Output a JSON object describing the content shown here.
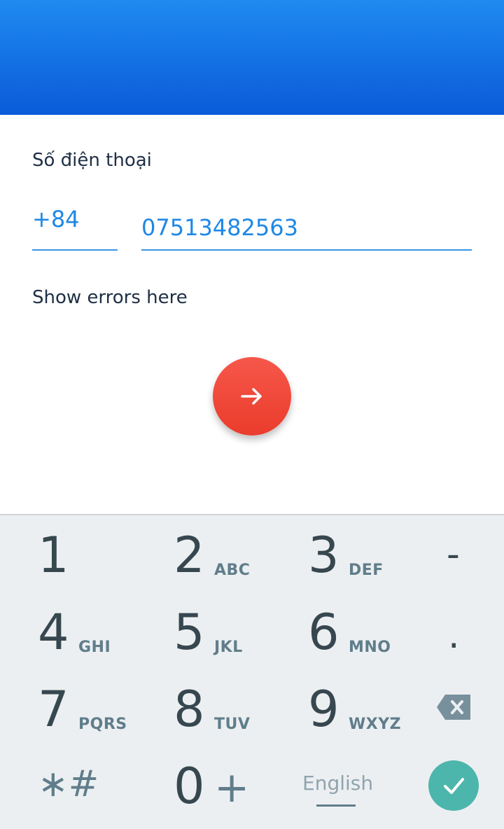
{
  "form": {
    "phone_label": "Số điện thoại",
    "country_code": "+84",
    "phone_number": "07513482563",
    "error_text": "Show errors here"
  },
  "colors": {
    "header_top": "#1f8af0",
    "header_bottom": "#0a5bd8",
    "accent": "#1e88e5",
    "fab": "#f44336",
    "done": "#4db6ac"
  },
  "keyboard": {
    "keys": [
      {
        "digit": "1",
        "letters": ""
      },
      {
        "digit": "2",
        "letters": "ABC"
      },
      {
        "digit": "3",
        "letters": "DEF"
      },
      {
        "digit": "4",
        "letters": "GHI"
      },
      {
        "digit": "5",
        "letters": "JKL"
      },
      {
        "digit": "6",
        "letters": "MNO"
      },
      {
        "digit": "7",
        "letters": "PQRS"
      },
      {
        "digit": "8",
        "letters": "TUV"
      },
      {
        "digit": "9",
        "letters": "WXYZ"
      },
      {
        "digit": "0",
        "letters": "+"
      }
    ],
    "dash": "-",
    "dot": ".",
    "star_hash": "∗#",
    "language": "English",
    "icons": {
      "backspace": "backspace-icon",
      "done": "checkmark-icon",
      "next": "arrow-right-icon"
    }
  }
}
